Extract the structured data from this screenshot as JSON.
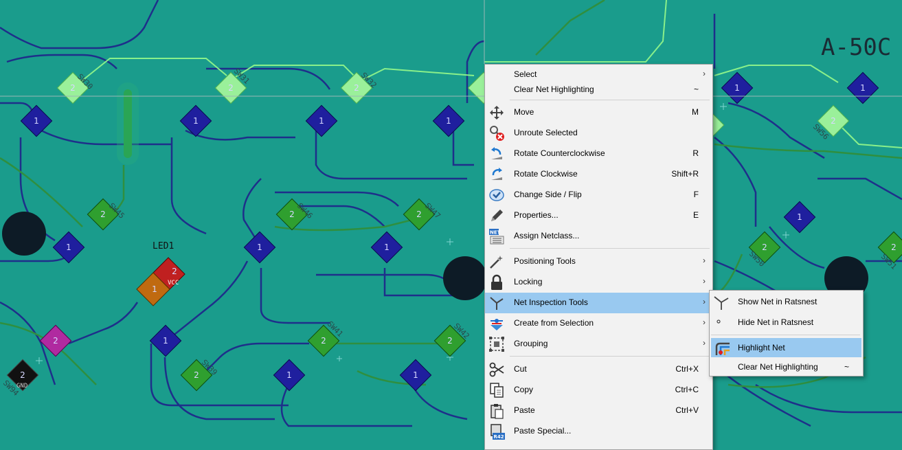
{
  "board": {
    "labels": {
      "title": "A-50C",
      "led": "LED1",
      "vcc": "VCC",
      "gnd": "GND"
    },
    "silkscreen": [
      "SW30",
      "SW31",
      "SW32",
      "SW45",
      "SW46",
      "SW47",
      "SW39",
      "SW41",
      "SW42",
      "SW50",
      "SW51",
      "SW56",
      "SW94"
    ],
    "colors": {
      "board": "#1a9c8c",
      "trace": "#1e2f8a",
      "highlight": "#7cf07c",
      "pad_blue": "#1f1f9e",
      "pad_green": "#2f9f2f"
    }
  },
  "context_menu": {
    "items": [
      {
        "label": "Select",
        "shortcut": "",
        "submenu": true,
        "icon": ""
      },
      {
        "label": "Clear Net Highlighting",
        "shortcut": "~",
        "submenu": false,
        "icon": ""
      },
      {
        "label": "Move",
        "shortcut": "M",
        "submenu": false,
        "icon": "move-icon"
      },
      {
        "label": "Unroute Selected",
        "shortcut": "",
        "submenu": false,
        "icon": "unroute-icon"
      },
      {
        "label": "Rotate Counterclockwise",
        "shortcut": "R",
        "submenu": false,
        "icon": "rotate-ccw-icon"
      },
      {
        "label": "Rotate Clockwise",
        "shortcut": "Shift+R",
        "submenu": false,
        "icon": "rotate-cw-icon"
      },
      {
        "label": "Change Side / Flip",
        "shortcut": "F",
        "submenu": false,
        "icon": "flip-icon"
      },
      {
        "label": "Properties...",
        "shortcut": "E",
        "submenu": false,
        "icon": "pencil-icon"
      },
      {
        "label": "Assign Netclass...",
        "shortcut": "",
        "submenu": false,
        "icon": "netclass-icon"
      },
      {
        "label": "Positioning Tools",
        "shortcut": "",
        "submenu": true,
        "icon": "magic-wand-icon"
      },
      {
        "label": "Locking",
        "shortcut": "",
        "submenu": true,
        "icon": "lock-icon"
      },
      {
        "label": "Net Inspection Tools",
        "shortcut": "",
        "submenu": true,
        "icon": "net-inspect-icon"
      },
      {
        "label": "Create from Selection",
        "shortcut": "",
        "submenu": true,
        "icon": "create-from-selection-icon"
      },
      {
        "label": "Grouping",
        "shortcut": "",
        "submenu": true,
        "icon": "grouping-icon"
      },
      {
        "label": "Cut",
        "shortcut": "Ctrl+X",
        "submenu": false,
        "icon": "scissors-icon"
      },
      {
        "label": "Copy",
        "shortcut": "Ctrl+C",
        "submenu": false,
        "icon": "copy-icon"
      },
      {
        "label": "Paste",
        "shortcut": "Ctrl+V",
        "submenu": false,
        "icon": "paste-icon"
      },
      {
        "label": "Paste Special...",
        "shortcut": "",
        "submenu": false,
        "icon": "paste-special-icon"
      }
    ],
    "arrow": "›",
    "icon_text": {
      "net": "NET",
      "r42": "R42"
    }
  },
  "submenu": {
    "parent": "Net Inspection Tools",
    "items": [
      {
        "label": "Show Net in Ratsnest",
        "shortcut": "",
        "icon": "ratsnest-show-icon"
      },
      {
        "label": "Hide Net in Ratsnest",
        "shortcut": "",
        "icon": "ratsnest-hide-icon"
      },
      {
        "label": "Highlight Net",
        "shortcut": "",
        "icon": "highlight-net-icon"
      },
      {
        "label": "Clear Net Highlighting",
        "shortcut": "~",
        "icon": ""
      }
    ]
  }
}
